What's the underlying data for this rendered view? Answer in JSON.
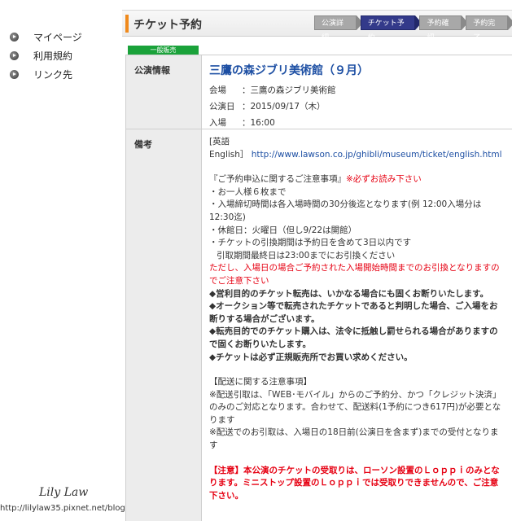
{
  "sidebar": {
    "items": [
      {
        "label": "マイページ"
      },
      {
        "label": "利用規約"
      },
      {
        "label": "リンク先"
      }
    ]
  },
  "header": {
    "title": "チケット予約",
    "steps": [
      {
        "label": "公演詳細"
      },
      {
        "label": "チケット予約"
      },
      {
        "label": "予約確認"
      },
      {
        "label": "予約完了"
      }
    ]
  },
  "status_tag": "一般販売",
  "performance": {
    "label": "公演情報",
    "title": "三鷹の森ジブリ美術館（９月）",
    "venue_key": "会場",
    "venue_value": "：三鷹の森ジブリ美術館",
    "date_key": "公演日",
    "date_value": "：2015/09/17（木）",
    "entry_key": "入場",
    "entry_value": "：16:00"
  },
  "notes": {
    "label": "備考",
    "english_prefix_1": "[英語",
    "english_prefix_2": "English］",
    "english_link": "http://www.lawson.co.jp/ghibli/museum/ticket/english.html",
    "caution_heading": "『ご予約申込に関するご注意事項』",
    "caution_must_read": "※必ずお読み下さい",
    "item1": "・お一人様６枚まで",
    "item2": "・入場締切時間は各入場時間の30分後迄となります(例 12:00入場分は12:30迄)",
    "item3": "・休館日：火曜日（但し9/22は開館）",
    "item4a": "・チケットの引換期間は予約日を含めて3日以内です",
    "item4b": "引取期間最終日は23:00までにお引換ください",
    "warning_red": "ただし、入場日の場合ご予約された入場開始時間までのお引換となりますのでご注意下さい",
    "bold1": "◆営利目的のチケット転売は、いかなる場合にも固くお断りいたします。",
    "bold2": "◆オークション等で転売されたチケットであると判明した場合、ご入場をお断りする場合がございます。",
    "bold3": "◆転売目的でのチケット購入は、法令に抵触し罰せられる場合がありますので固くお断りいたします。",
    "bold4": "◆チケットは必ず正規販売所でお買い求めください。",
    "delivery_heading": "【配送に関する注意事項】",
    "delivery1": "※配送引取は、「WEB･モバイル」からのご予約分、かつ「クレジット決済」のみのご対応となります。合わせて、配送料(1予約につき617円)が必要となります",
    "delivery2": "※配送でのお引取は、入場日の18日前(公演日を含まず)までの受付となります",
    "final_red": "【注意】本公演のチケットの受取りは、ローソン設置のＬｏｐｐｉのみとなります。ミニストップ設置のＬｏｐｐｉでは受取りできませんので、ご注意下さい。"
  },
  "watermark": {
    "name": "Lily Law",
    "url": "http://lilylaw35.pixnet.net/blog"
  },
  "colors": {
    "accent_orange": "#f08a1c",
    "step_active": "#333a8a",
    "title_blue": "#1d4fa3",
    "warning_red": "#e60012",
    "tag_green": "#1aa23a"
  }
}
